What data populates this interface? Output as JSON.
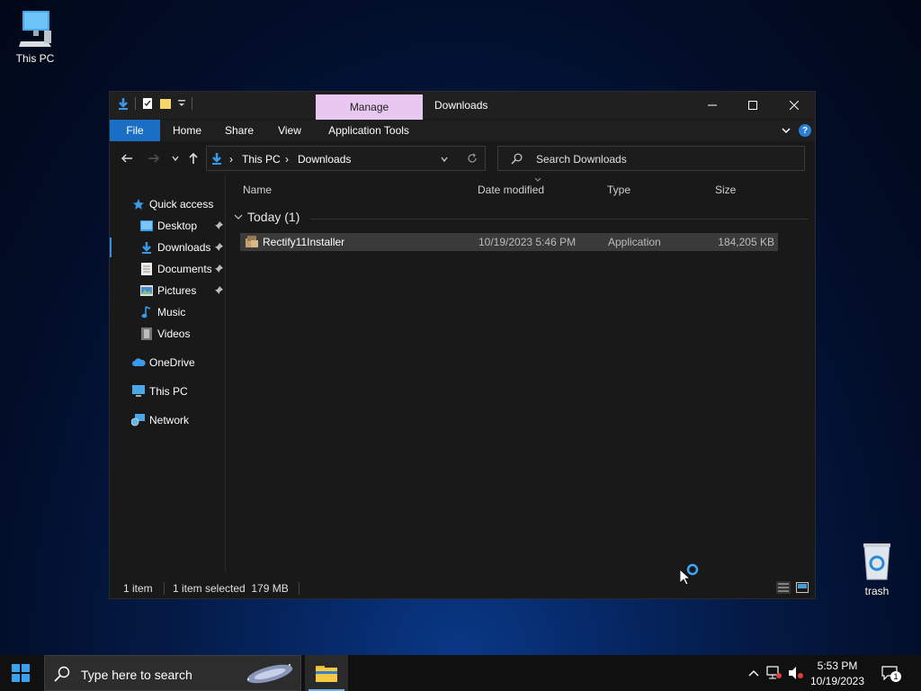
{
  "desktop": {
    "this_pc_label": "This PC",
    "trash_label": "trash"
  },
  "window": {
    "context_tab": "Manage",
    "title": "Downloads",
    "ribbon_tabs": [
      "File",
      "Home",
      "Share",
      "View",
      "Application Tools"
    ],
    "breadcrumb": [
      "This PC",
      "Downloads"
    ],
    "search_placeholder": "Search Downloads",
    "nav_pane": {
      "quick_access": "Quick access",
      "items": [
        "Desktop",
        "Downloads",
        "Documents",
        "Pictures",
        "Music",
        "Videos"
      ],
      "onedrive": "OneDrive",
      "this_pc": "This PC",
      "network": "Network"
    },
    "columns": [
      "Name",
      "Date modified",
      "Type",
      "Size"
    ],
    "group_label": "Today (1)",
    "files": [
      {
        "name": "Rectify11Installer",
        "date": "10/19/2023 5:46 PM",
        "type": "Application",
        "size": "184,205 KB"
      }
    ],
    "status": {
      "count": "1 item",
      "selected": "1 item selected  179 MB"
    }
  },
  "taskbar": {
    "search_placeholder": "Type here to search",
    "time": "5:53 PM",
    "date": "10/19/2023",
    "notification_count": "1"
  },
  "colors": {
    "accent": "#1a6fc4",
    "manage_tab": "#e8c8f0",
    "window_bg": "#191919"
  }
}
